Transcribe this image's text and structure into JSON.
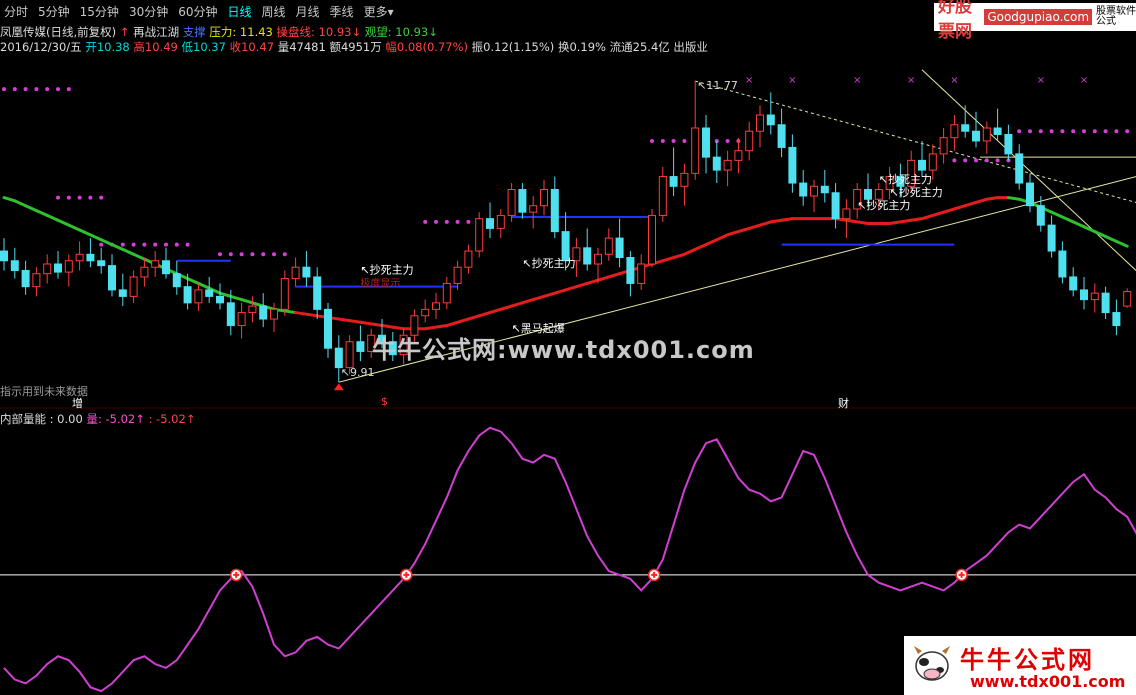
{
  "toolbar": {
    "tabs": [
      "分时",
      "5分钟",
      "15分钟",
      "30分钟",
      "60分钟",
      "日线",
      "周线",
      "月线",
      "季线",
      "更多"
    ],
    "active": "日线",
    "more_arrow": "▾"
  },
  "brand": {
    "name": "好股票网",
    "url": "Goodgupiao.com",
    "tag": "股票软件公式"
  },
  "header": {
    "stock": "凤凰传媒(日线,前复权)",
    "formula_icon": "↑",
    "formula": "再战江湖",
    "support": "支撑",
    "pressure": "压力: 11.43",
    "pan": "操盘线: 10.93↓",
    "watch": "观望: 10.93↓"
  },
  "quote": {
    "date": "2016/12/30/五",
    "open": "开10.38",
    "high": "高10.49",
    "low": "低10.37",
    "close": "收10.47",
    "volume": "量47481",
    "amount": "额4951万",
    "change": "幅0.08(0.77%)",
    "amplitude": "振0.12(1.15%)",
    "turnover": "换0.19%",
    "float": "流通25.4亿",
    "sector": "出版业"
  },
  "annotations": {
    "high": "11.77",
    "low": "9.91",
    "buy1": "抄死主力",
    "buy2": "抄死主力",
    "buy3": "抄死主力",
    "buy4": "抄死主力",
    "buy5": "抄死主力",
    "dark_horse": "黑马起爆",
    "hidden_sign": "极度显示",
    "future_note": "指示用到未来数据",
    "event_zeng": "增",
    "event_dollar": "$",
    "event_cai": "财"
  },
  "indicator": {
    "name": "内部量能",
    "value": ": 0.00",
    "liang": "量: -5.02↑",
    "second": ": -5.02↑"
  },
  "watermark": {
    "center": "牛牛公式网:www.tdx001.com",
    "corner_big": "牛牛公式网",
    "corner_small": "www.tdx001.com"
  },
  "colors": {
    "up": "#ff3b3b",
    "down": "#4fe0f0",
    "ma_green": "#2fbf2f",
    "ma_red": "#e61c1c",
    "dots": "#d53fd5",
    "support": "#2233ff",
    "trend": "#e8e8a0",
    "indicator": "#d040d0"
  },
  "chart_data": [
    {
      "type": "candlestick",
      "title": "凤凰传媒(日线,前复权)",
      "price_range": [
        9.8,
        11.9
      ],
      "price_high": 11.77,
      "price_low": 9.91,
      "last_close": 10.47,
      "candles_ohlc": [
        [
          10.72,
          10.8,
          10.6,
          10.66
        ],
        [
          10.66,
          10.74,
          10.55,
          10.6
        ],
        [
          10.6,
          10.66,
          10.45,
          10.5
        ],
        [
          10.5,
          10.62,
          10.44,
          10.58
        ],
        [
          10.58,
          10.7,
          10.52,
          10.64
        ],
        [
          10.64,
          10.72,
          10.55,
          10.59
        ],
        [
          10.59,
          10.7,
          10.5,
          10.66
        ],
        [
          10.66,
          10.78,
          10.6,
          10.7
        ],
        [
          10.7,
          10.8,
          10.62,
          10.66
        ],
        [
          10.66,
          10.74,
          10.58,
          10.63
        ],
        [
          10.63,
          10.7,
          10.44,
          10.48
        ],
        [
          10.48,
          10.58,
          10.38,
          10.44
        ],
        [
          10.44,
          10.6,
          10.4,
          10.56
        ],
        [
          10.56,
          10.68,
          10.5,
          10.62
        ],
        [
          10.62,
          10.72,
          10.56,
          10.66
        ],
        [
          10.66,
          10.74,
          10.55,
          10.58
        ],
        [
          10.58,
          10.66,
          10.45,
          10.5
        ],
        [
          10.5,
          10.58,
          10.36,
          10.4
        ],
        [
          10.4,
          10.52,
          10.35,
          10.48
        ],
        [
          10.48,
          10.56,
          10.4,
          10.44
        ],
        [
          10.44,
          10.52,
          10.36,
          10.4
        ],
        [
          10.4,
          10.48,
          10.2,
          10.26
        ],
        [
          10.26,
          10.4,
          10.18,
          10.34
        ],
        [
          10.34,
          10.44,
          10.28,
          10.38
        ],
        [
          10.38,
          10.46,
          10.25,
          10.3
        ],
        [
          10.3,
          10.4,
          10.22,
          10.36
        ],
        [
          10.36,
          10.6,
          10.32,
          10.55
        ],
        [
          10.55,
          10.68,
          10.5,
          10.62
        ],
        [
          10.62,
          10.72,
          10.5,
          10.56
        ],
        [
          10.56,
          10.62,
          10.3,
          10.36
        ],
        [
          10.36,
          10.4,
          10.06,
          10.12
        ],
        [
          10.12,
          10.2,
          9.91,
          10.0
        ],
        [
          10.0,
          10.2,
          9.96,
          10.16
        ],
        [
          10.16,
          10.26,
          10.04,
          10.1
        ],
        [
          10.1,
          10.24,
          10.06,
          10.2
        ],
        [
          10.2,
          10.3,
          10.12,
          10.16
        ],
        [
          10.16,
          10.22,
          10.04,
          10.08
        ],
        [
          10.08,
          10.24,
          10.02,
          10.2
        ],
        [
          10.2,
          10.36,
          10.16,
          10.32
        ],
        [
          10.32,
          10.42,
          10.28,
          10.36
        ],
        [
          10.36,
          10.46,
          10.3,
          10.4
        ],
        [
          10.4,
          10.56,
          10.36,
          10.52
        ],
        [
          10.52,
          10.66,
          10.48,
          10.62
        ],
        [
          10.62,
          10.76,
          10.58,
          10.72
        ],
        [
          10.72,
          10.96,
          10.68,
          10.92
        ],
        [
          10.92,
          11.02,
          10.8,
          10.86
        ],
        [
          10.86,
          10.98,
          10.8,
          10.94
        ],
        [
          10.94,
          11.14,
          10.9,
          11.1
        ],
        [
          11.1,
          11.14,
          10.92,
          10.96
        ],
        [
          10.96,
          11.06,
          10.86,
          11.0
        ],
        [
          11.0,
          11.16,
          10.94,
          11.1
        ],
        [
          11.1,
          11.18,
          10.8,
          10.84
        ],
        [
          10.84,
          10.96,
          10.6,
          10.66
        ],
        [
          10.66,
          10.8,
          10.56,
          10.74
        ],
        [
          10.74,
          10.86,
          10.6,
          10.64
        ],
        [
          10.64,
          10.74,
          10.52,
          10.7
        ],
        [
          10.7,
          10.86,
          10.66,
          10.8
        ],
        [
          10.8,
          10.92,
          10.62,
          10.68
        ],
        [
          10.68,
          10.72,
          10.44,
          10.52
        ],
        [
          10.52,
          10.7,
          10.48,
          10.64
        ],
        [
          10.64,
          10.98,
          10.62,
          10.94
        ],
        [
          10.94,
          11.24,
          10.9,
          11.18
        ],
        [
          11.18,
          11.36,
          11.06,
          11.12
        ],
        [
          11.12,
          11.26,
          11.0,
          11.2
        ],
        [
          11.2,
          11.77,
          11.16,
          11.48
        ],
        [
          11.48,
          11.56,
          11.2,
          11.3
        ],
        [
          11.3,
          11.4,
          11.14,
          11.22
        ],
        [
          11.22,
          11.34,
          11.12,
          11.28
        ],
        [
          11.28,
          11.42,
          11.2,
          11.34
        ],
        [
          11.34,
          11.52,
          11.28,
          11.46
        ],
        [
          11.46,
          11.62,
          11.36,
          11.56
        ],
        [
          11.56,
          11.7,
          11.44,
          11.5
        ],
        [
          11.5,
          11.6,
          11.3,
          11.36
        ],
        [
          11.36,
          11.44,
          11.08,
          11.14
        ],
        [
          11.14,
          11.22,
          11.0,
          11.06
        ],
        [
          11.06,
          11.16,
          10.96,
          11.12
        ],
        [
          11.12,
          11.22,
          11.02,
          11.08
        ],
        [
          11.08,
          11.14,
          10.86,
          10.92
        ],
        [
          10.92,
          11.04,
          10.8,
          10.98
        ],
        [
          10.98,
          11.14,
          10.92,
          11.1
        ],
        [
          11.1,
          11.2,
          11.0,
          11.04
        ],
        [
          11.04,
          11.14,
          10.98,
          11.1
        ],
        [
          11.1,
          11.24,
          11.04,
          11.18
        ],
        [
          11.18,
          11.26,
          11.06,
          11.12
        ],
        [
          11.12,
          11.34,
          11.08,
          11.28
        ],
        [
          11.28,
          11.4,
          11.18,
          11.22
        ],
        [
          11.22,
          11.38,
          11.16,
          11.32
        ],
        [
          11.32,
          11.48,
          11.26,
          11.42
        ],
        [
          11.42,
          11.56,
          11.34,
          11.5
        ],
        [
          11.5,
          11.62,
          11.42,
          11.46
        ],
        [
          11.46,
          11.58,
          11.36,
          11.4
        ],
        [
          11.4,
          11.52,
          11.32,
          11.48
        ],
        [
          11.48,
          11.6,
          11.4,
          11.44
        ],
        [
          11.44,
          11.5,
          11.28,
          11.32
        ],
        [
          11.32,
          11.38,
          11.1,
          11.14
        ],
        [
          11.14,
          11.2,
          10.96,
          11.0
        ],
        [
          11.0,
          11.06,
          10.84,
          10.88
        ],
        [
          10.88,
          10.94,
          10.68,
          10.72
        ],
        [
          10.72,
          10.78,
          10.52,
          10.56
        ],
        [
          10.56,
          10.62,
          10.44,
          10.48
        ],
        [
          10.48,
          10.56,
          10.36,
          10.42
        ],
        [
          10.42,
          10.52,
          10.34,
          10.46
        ],
        [
          10.46,
          10.5,
          10.3,
          10.34
        ],
        [
          10.34,
          10.42,
          10.2,
          10.26
        ],
        [
          10.38,
          10.49,
          10.37,
          10.47
        ]
      ],
      "ma_slow": [
        11.05,
        11.03,
        11.0,
        10.97,
        10.94,
        10.91,
        10.88,
        10.85,
        10.82,
        10.79,
        10.76,
        10.73,
        10.7,
        10.67,
        10.64,
        10.61,
        10.58,
        10.55,
        10.52,
        10.49,
        10.46,
        10.44,
        10.42,
        10.4,
        10.38,
        10.36,
        10.35,
        10.34,
        10.33,
        10.32,
        10.31,
        10.3,
        10.29,
        10.28,
        10.27,
        10.26,
        10.25,
        10.24,
        10.24,
        10.24,
        10.25,
        10.26,
        10.28,
        10.3,
        10.32,
        10.34,
        10.36,
        10.38,
        10.4,
        10.42,
        10.44,
        10.46,
        10.48,
        10.5,
        10.52,
        10.54,
        10.56,
        10.58,
        10.6,
        10.62,
        10.64,
        10.66,
        10.68,
        10.7,
        10.73,
        10.76,
        10.79,
        10.82,
        10.84,
        10.86,
        10.88,
        10.9,
        10.91,
        10.92,
        10.92,
        10.92,
        10.92,
        10.92,
        10.91,
        10.9,
        10.89,
        10.89,
        10.89,
        10.9,
        10.91,
        10.92,
        10.94,
        10.96,
        10.98,
        11.0,
        11.02,
        11.04,
        11.05,
        11.05,
        11.04,
        11.02,
        10.99,
        10.96,
        10.93,
        10.9,
        10.87,
        10.84,
        10.81,
        10.78,
        10.75
      ],
      "support_price": [
        10.66,
        10.5,
        10.93,
        10.76
      ],
      "trendlines": [
        "from 9.91 rising to the upper right",
        "from 11.77 falling dotted",
        "steep downtrend from top right"
      ],
      "markers": [
        "抄死主力",
        "抄死主力",
        "黑马起爆",
        "抄死主力",
        "抄死主力",
        "抄死主力"
      ]
    },
    {
      "type": "line",
      "title": "内部量能",
      "series": [
        {
          "name": "量",
          "values": [
            -12.0,
            -13.5,
            -14.0,
            -13.0,
            -11.5,
            -10.5,
            -11.0,
            -12.5,
            -14.5,
            -15.0,
            -14.0,
            -12.5,
            -11.0,
            -10.5,
            -11.5,
            -12.0,
            -11.0,
            -9.0,
            -7.0,
            -4.5,
            -2.0,
            -0.5,
            0.5,
            -1.5,
            -5.0,
            -9.0,
            -10.5,
            -10.0,
            -8.5,
            -8.0,
            -9.0,
            -9.5,
            -8.0,
            -6.5,
            -5.0,
            -3.5,
            -2.0,
            -0.5,
            1.5,
            4.0,
            7.0,
            10.0,
            13.5,
            16.0,
            18.0,
            19.0,
            18.5,
            17.0,
            15.0,
            14.5,
            15.5,
            15.0,
            12.0,
            8.5,
            5.0,
            2.5,
            0.5,
            0.0,
            -0.5,
            -2.0,
            -0.5,
            2.0,
            6.5,
            11.0,
            14.5,
            17.0,
            17.5,
            15.0,
            12.5,
            11.0,
            10.5,
            9.5,
            10.0,
            13.0,
            16.0,
            15.5,
            12.5,
            9.0,
            5.5,
            2.5,
            0.0,
            -1.0,
            -1.5,
            -2.0,
            -1.5,
            -1.0,
            -1.5,
            -2.0,
            -1.0,
            0.5,
            1.5,
            2.5,
            4.0,
            5.5,
            6.5,
            6.0,
            7.5,
            9.0,
            10.5,
            12.0,
            13.0,
            11.0,
            10.0,
            8.5,
            7.5,
            5.0
          ]
        }
      ],
      "zero_line": 0.0,
      "current": "-5.02"
    }
  ]
}
